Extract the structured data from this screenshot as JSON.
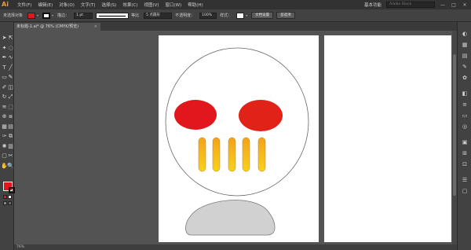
{
  "app": {
    "logo": "Ai"
  },
  "menu": [
    "文件(F)",
    "编辑(E)",
    "对象(O)",
    "文字(T)",
    "选择(S)",
    "效果(C)",
    "视图(V)",
    "窗口(W)",
    "帮助(H)"
  ],
  "top_right": {
    "workspace": "基本功能",
    "search_placeholder": "Adobe Stock",
    "minimize": "—",
    "maximize": "□",
    "close": "✕"
  },
  "control_bar": {
    "selection_label": "未选择对象",
    "fill_color": "#e1171d",
    "stroke_label": "描边：",
    "stroke_weight": "1 pt",
    "stroke_profile": "等比",
    "brush": "5 点圆形",
    "opacity_label": "不透明度：",
    "opacity_value": "100%",
    "style_label": "样式：",
    "doc_setup": "文档设置",
    "preferences": "首选项"
  },
  "document_tab": {
    "title": "未标题-1.ai* @ 76% (CMYK/预览)",
    "close": "×"
  },
  "toolbar_icons": [
    "selection-icon",
    "direct-selection-icon",
    "magic-wand-icon",
    "lasso-icon",
    "pen-icon",
    "curvature-icon",
    "type-icon",
    "line-icon",
    "rectangle-icon",
    "paintbrush-icon",
    "pencil-icon",
    "eraser-icon",
    "rotate-icon",
    "scale-icon",
    "width-icon",
    "free-transform-icon",
    "shape-builder-icon",
    "perspective-icon",
    "mesh-icon",
    "gradient-icon",
    "eyedropper-icon",
    "blend-icon",
    "symbol-sprayer-icon",
    "column-graph-icon",
    "artboard-icon",
    "slice-icon",
    "hand-icon",
    "zoom-icon"
  ],
  "colors": {
    "face_fill": "#ffffff",
    "face_stroke": "#666666",
    "eye_fill": "#e1171d",
    "eye_right_fill": "#e02219",
    "teeth_top": "#f4a21b",
    "teeth_bottom": "#f7d21a",
    "chin_fill": "#d1d1d1",
    "chin_stroke": "#777777"
  },
  "status": {
    "zoom": "76%"
  }
}
